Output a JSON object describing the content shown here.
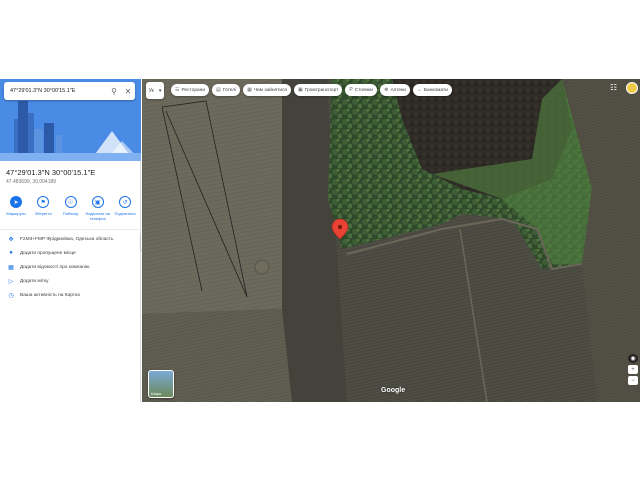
{
  "search": {
    "query": "47°29'01.3\"N 30°00'15.1\"E"
  },
  "place": {
    "title": "47°29'01.3\"N 30°00'15.1\"E",
    "coords": "47.483699, 30.004189"
  },
  "actions": [
    {
      "label": "Маршрути",
      "icon": "directions-icon"
    },
    {
      "label": "Зберегти",
      "icon": "bookmark-icon"
    },
    {
      "label": "Поблизу",
      "icon": "nearby-icon"
    },
    {
      "label": "Надіслати на телефон",
      "icon": "send-to-phone-icon"
    },
    {
      "label": "Поділитися",
      "icon": "share-icon"
    }
  ],
  "info_rows": [
    {
      "text": "F2M3+FMP Фрідрихівка, Одеська область",
      "icon": "plus-code-icon"
    },
    {
      "text": "Додати пропущене місце",
      "icon": "add-place-icon"
    },
    {
      "text": "Додати відомості про компанію",
      "icon": "business-icon"
    },
    {
      "text": "Додати мітку",
      "icon": "label-icon"
    },
    {
      "text": "Ваша активність на Картах",
      "icon": "history-icon"
    }
  ],
  "map": {
    "lang_label": "Ук",
    "chips": [
      {
        "label": "Ресторани",
        "icon": "restaurant-icon"
      },
      {
        "label": "Готелі",
        "icon": "hotel-icon"
      },
      {
        "label": "Чим зайнятися",
        "icon": "things-to-do-icon"
      },
      {
        "label": "Громтранспорт",
        "icon": "transit-icon"
      },
      {
        "label": "Стоянки",
        "icon": "parking-icon"
      },
      {
        "label": "Аптеки",
        "icon": "pharmacy-icon"
      },
      {
        "label": "Банкомати",
        "icon": "atm-icon"
      }
    ],
    "layer_label": "Шари",
    "attribution": "Google"
  },
  "colors": {
    "accent": "#1a73e8",
    "pin": "#ea4335"
  }
}
